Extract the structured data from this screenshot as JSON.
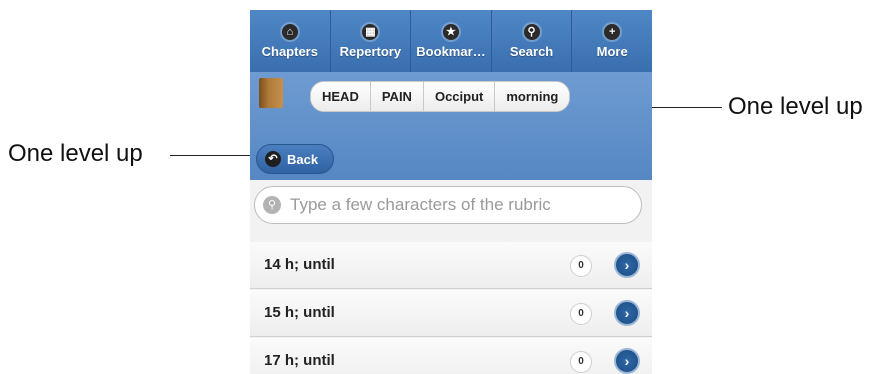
{
  "nav": {
    "tabs": [
      {
        "label": "Chapters",
        "icon": "home-icon",
        "glyph": "⌂"
      },
      {
        "label": "Repertory",
        "icon": "grid-icon",
        "glyph": "▦"
      },
      {
        "label": "Bookmar…",
        "icon": "star-icon",
        "glyph": "★"
      },
      {
        "label": "Search",
        "icon": "search-icon",
        "glyph": "⚲"
      },
      {
        "label": "More",
        "icon": "plus-icon",
        "glyph": "+"
      }
    ]
  },
  "breadcrumb": [
    "HEAD",
    "PAIN",
    "Occiput",
    "morning"
  ],
  "back_label": "Back",
  "search": {
    "placeholder": "Type a few characters of the rubric"
  },
  "rows": [
    {
      "label": "14 h; until",
      "count": "0"
    },
    {
      "label": "15 h; until",
      "count": "0"
    },
    {
      "label": "17 h; until",
      "count": "0"
    }
  ],
  "annotations": {
    "left": "One level up",
    "right": "One level up"
  },
  "colors": {
    "nav": "#3a6faf",
    "header": "#5687c4",
    "accent": "#1a4a80"
  }
}
